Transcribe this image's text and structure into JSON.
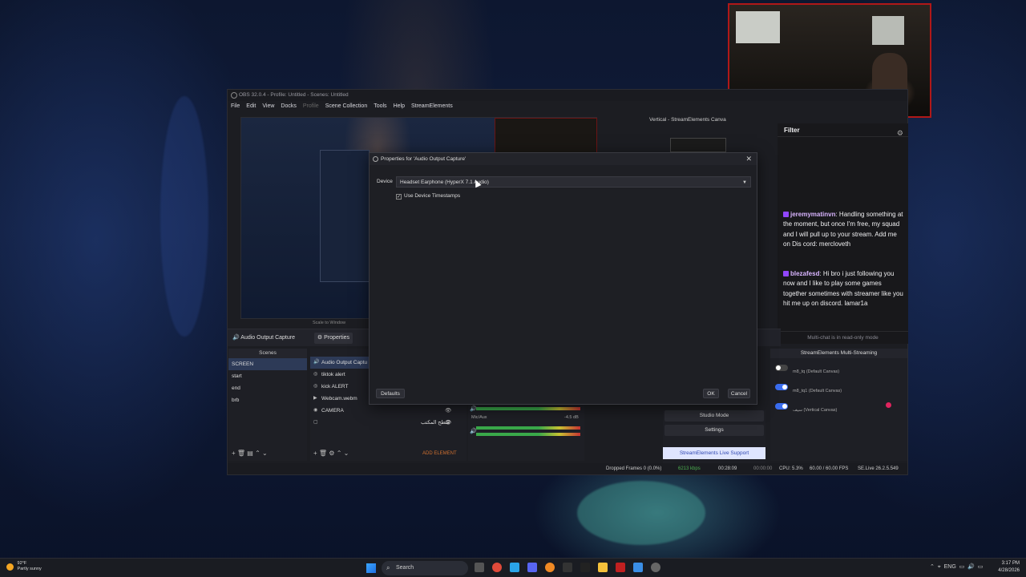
{
  "taskbar": {
    "weather_temp": "92°F",
    "weather_desc": "Partly sunny",
    "search_label": "Search",
    "lang": "ENG",
    "time": "3:17 PM",
    "date": "4/28/2026"
  },
  "obs": {
    "title": "OBS 32.0.4 - Profile: Untitled - Scenes: Untitled",
    "menu": [
      "File",
      "Edit",
      "View",
      "Docks",
      "Profile",
      "Scene Collection",
      "Tools",
      "Help",
      "StreamElements"
    ],
    "preview_scale": "Scale to Window",
    "vertical_canvas_title": "Vertical - StreamElements Canva",
    "selected_source": "Audio Output Capture",
    "properties_btn": "Properties",
    "scenes_header": "Scenes",
    "scenes": [
      "SCREEN",
      "start",
      "end",
      "brb"
    ],
    "sources": [
      {
        "label": "Audio Output Captu",
        "icon": "speaker-icon"
      },
      {
        "label": "tiktok alert",
        "icon": "globe-icon"
      },
      {
        "label": "kick ALERT",
        "icon": "globe-icon"
      },
      {
        "label": "Webcam.webm",
        "icon": "play-icon"
      },
      {
        "label": "CAMERA",
        "icon": "camera-icon"
      },
      {
        "label": "سطح المكتب",
        "icon": "display-icon"
      }
    ],
    "add_element": "ADD ELEMENT",
    "mixer_label": "Mic/Aux",
    "mixer_db": "-4.5 dB",
    "studio_mode": "Studio Mode",
    "settings": "Settings",
    "se_support": "StreamElements Live Support",
    "multistream_title": "StreamElements Multi-Streaming",
    "multistream": [
      {
        "name": "m8_tq (Default Canvas)",
        "enabled": false
      },
      {
        "name": "m8_tq1 (Default Canvas)",
        "enabled": true
      },
      {
        "name": "سيف (Vertical Canvas)",
        "enabled": true
      }
    ],
    "status": {
      "dropped": "Dropped Frames 0 (0.0%)",
      "bitrate": "6213 kbps",
      "rec_time": "00:28:09",
      "stream_time": "00:00:00",
      "cpu": "CPU: 5.3%",
      "fps": "60.00 / 60.00 FPS",
      "version": "SE.Live 26.2.5.549"
    }
  },
  "chat": {
    "filter_label": "Filter",
    "messages": [
      {
        "user": "jeremymatinvn",
        "text": ": Handling something at the moment, but once I'm free, my squad and I will pull up to your stream. Add me on Dis cord: mercloveth"
      },
      {
        "user": "blezafesd",
        "text": ": Hi bro i just following you now and I like to play some games together sometimes with streamer like you hit me up on discord. lamar1a"
      }
    ],
    "footer": "Multi-chat is in read-only mode"
  },
  "dialog": {
    "title": "Properties for 'Audio Output Capture'",
    "device_label": "Device",
    "device_value": "Headset Earphone (HyperX 7.1 Audio)",
    "timestamps_label": "Use Device Timestamps",
    "timestamps_checked": true,
    "defaults_btn": "Defaults",
    "ok_btn": "OK",
    "cancel_btn": "Cancel"
  }
}
